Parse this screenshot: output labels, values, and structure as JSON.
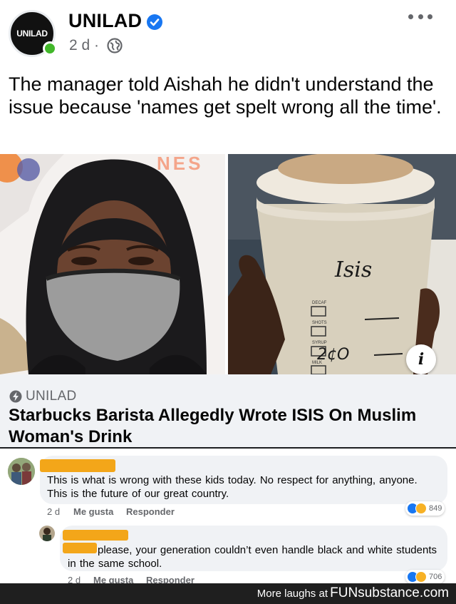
{
  "post": {
    "page_name": "UNILAD",
    "avatar_text": "UNILAD",
    "time": "2 d ·",
    "text": "The manager told Aishah he didn't understand the issue because 'names get spelt wrong all the time'."
  },
  "images": {
    "banner_text": "NES",
    "cup_name": "Isis",
    "cup_labels": [
      "DECAF",
      "SHOTS",
      "SYRUP",
      "MILK"
    ],
    "cup_code": "2¢O",
    "info_label": "i"
  },
  "link": {
    "source": "UNILAD",
    "title": "Starbucks Barista Allegedly Wrote ISIS On Muslim Woman's Drink"
  },
  "comments": [
    {
      "text": "This is what is wrong with these kids today. No respect for anything, anyone. This is the future of our great country.",
      "time": "2 d",
      "like_label": "Me gusta",
      "reply_label": "Responder",
      "reaction_count": "849"
    },
    {
      "text": "please, your generation couldn’t even handle black and white students in the same school.",
      "time": "2 d",
      "like_label": "Me gusta",
      "reply_label": "Responder",
      "reaction_count": "706"
    }
  ],
  "footer": {
    "text": "More laughs at",
    "brand": "FUNsubstance.com"
  },
  "colors": {
    "verified": "#1877f2",
    "online": "#42b72a",
    "redaction": "#f3a619",
    "bubble": "#f0f2f5",
    "footer_bg": "#1f1f1f"
  }
}
